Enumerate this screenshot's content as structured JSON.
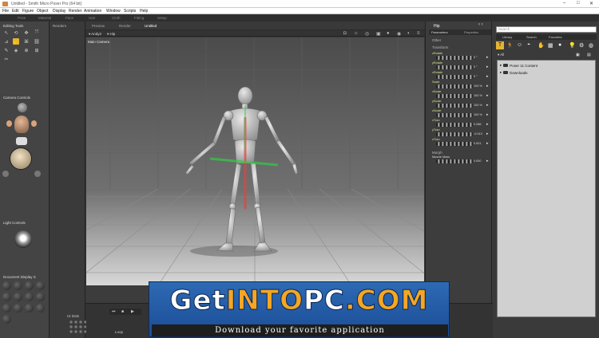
{
  "window": {
    "title": "Untitled - Smith Micro Poser Pro (64 bit)",
    "controls": [
      "–",
      "□",
      "✕"
    ]
  },
  "menu": [
    "File",
    "Edit",
    "Figure",
    "Object",
    "Display",
    "Render",
    "Animation",
    "Window",
    "Scripts",
    "Help"
  ],
  "rooms": [
    "Pose",
    "Material",
    "Face",
    "Hair",
    "Cloth",
    "Fitting",
    "Setup"
  ],
  "left_panel": {
    "editing_tools": "Editing Tools",
    "camera_controls": "Camera Controls",
    "light_controls": "Light Controls",
    "document_display": "Document Display S"
  },
  "renders_tab": "Renders",
  "document": {
    "tabs": [
      "Preview",
      "Render",
      "Untitled"
    ],
    "figure_select": "Andy2",
    "actor_select": "Hip",
    "camera_label": "Main Camera"
  },
  "params": {
    "title": "Hip",
    "tabs": [
      "Parameters",
      "Properties"
    ],
    "groups": [
      "Other",
      "Transform",
      "Morph"
    ],
    "rows": [
      {
        "label": "zRotate",
        "value": "0 °"
      },
      {
        "label": "yRotate",
        "value": "0 °"
      },
      {
        "label": "xRotate",
        "value": "0 °"
      },
      {
        "label": "Scale",
        "value": "100 %"
      },
      {
        "label": "xScale",
        "value": "100 %"
      },
      {
        "label": "yScale",
        "value": "100 %"
      },
      {
        "label": "zScale",
        "value": "100 %"
      },
      {
        "label": "xTran",
        "value": "0.286"
      },
      {
        "label": "yTran",
        "value": "-0.013"
      },
      {
        "label": "zTran",
        "value": "0.001"
      }
    ],
    "morph_row": {
      "label": "Muscle Mass",
      "value": "0.000"
    }
  },
  "library": {
    "search_placeholder": "Search",
    "tabs": [
      "Library",
      "Search",
      "Favorites"
    ],
    "filter": "All",
    "items": [
      "Poser 11 Content",
      "Downloads"
    ]
  },
  "timeline": {
    "ui_dots": "UI Dots",
    "loop": "Loop"
  },
  "watermark": {
    "title_part1": "Get",
    "title_part2": "INTO",
    "title_part3": "PC",
    "title_part4": ".COM",
    "subtitle": "Download your favorite application"
  },
  "colors": {
    "accent": "#e3b532",
    "param_label": "#cfe88a",
    "banner_blue": "#2e6ab4"
  }
}
